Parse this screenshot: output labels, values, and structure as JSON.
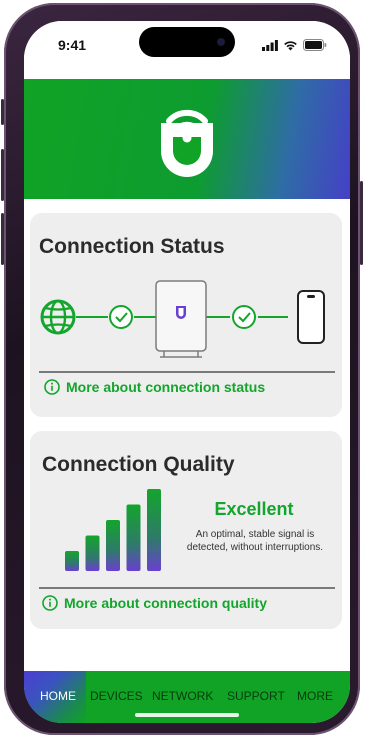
{
  "status_bar": {
    "time": "9:41"
  },
  "connection_status": {
    "title": "Connection Status",
    "link_text": "More about connection status",
    "nodes": [
      "globe-icon",
      "check-icon",
      "router-icon",
      "check-icon",
      "phone-icon"
    ]
  },
  "connection_quality": {
    "title": "Connection Quality",
    "level": "Excellent",
    "description": "An optimal, stable signal is detected, without interruptions.",
    "bars_filled": 5,
    "bars_total": 5,
    "link_text": "More about connection quality"
  },
  "bottom_nav": {
    "items": [
      {
        "label": "HOME",
        "active": true
      },
      {
        "label": "DEVICES",
        "active": false
      },
      {
        "label": "NETWORK",
        "active": false
      },
      {
        "label": "SUPPORT",
        "active": false
      },
      {
        "label": "MORE",
        "active": false
      }
    ]
  },
  "colors": {
    "brand_green": "#13a52c",
    "brand_purple": "#4c3fd0",
    "card_bg": "#eeeeee"
  }
}
